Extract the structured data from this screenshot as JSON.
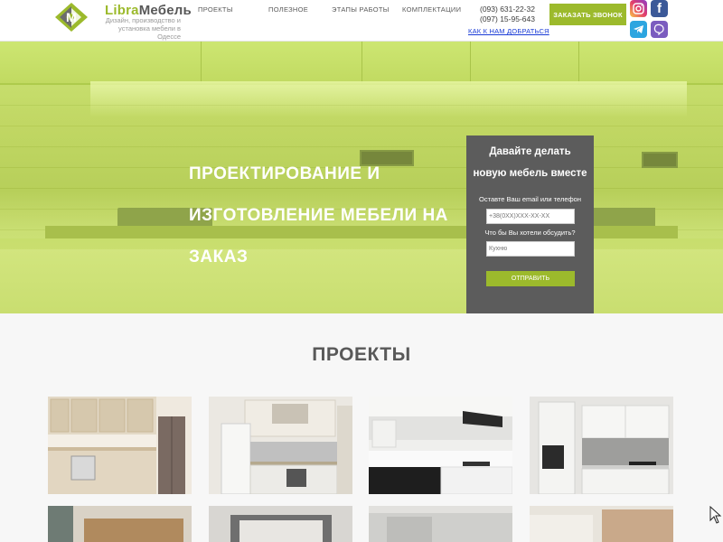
{
  "header": {
    "brand_part1": "Libra",
    "brand_part2": "Мебель",
    "tagline_line1": "Дизайн, производство и",
    "tagline_line2": "установка мебели в Одессе",
    "nav": [
      "ПРОЕКТЫ",
      "ПОЛЕЗНОЕ",
      "ЭТАПЫ РАБОТЫ",
      "КОМПЛЕКТАЦИИ"
    ],
    "phones": [
      "(093) 631-22-32",
      "(097) 15-95-643"
    ],
    "route_link": "КАК К НАМ ДОБРАТЬСЯ",
    "call_button": "ЗАКАЗАТЬ ЗВОНОК",
    "social_icons": [
      "instagram-icon",
      "facebook-icon",
      "telegram-icon",
      "viber-icon"
    ]
  },
  "hero": {
    "title_lines": [
      "ПРОЕКТИРОВАНИЕ И",
      "ИЗГОТОВЛЕНИЕ МЕБЕЛИ НА",
      "ЗАКАЗ"
    ]
  },
  "form": {
    "title_line1": "Давайте делать",
    "title_line2": "новую мебель вместе",
    "contact_label": "Оставте Ваш email или телефон",
    "contact_placeholder": "+38(0XX)XXX-XX-XX",
    "topic_label": "Что бы Вы хотели обсудить?",
    "topic_placeholder": "Кухню",
    "submit_label": "ОТПРАВИТЬ"
  },
  "projects": {
    "title": "ПРОЕКТЫ"
  },
  "colors": {
    "accent": "#9cba2c",
    "hero_green": "#c0d861",
    "form_bg": "#5c5c5c",
    "link": "#1a3bd6"
  }
}
